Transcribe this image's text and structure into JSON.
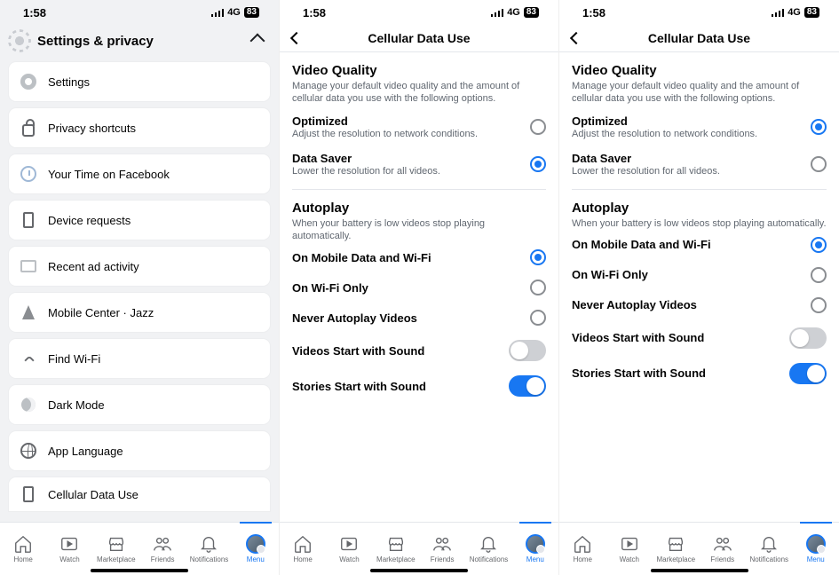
{
  "status": {
    "time": "1:58",
    "net": "4G",
    "battery": "83"
  },
  "screenA": {
    "header": "Settings & privacy",
    "items": [
      {
        "label": "Settings"
      },
      {
        "label": "Privacy shortcuts"
      },
      {
        "label": "Your Time on Facebook"
      },
      {
        "label": "Device requests"
      },
      {
        "label": "Recent ad activity"
      },
      {
        "label": "Mobile Center · Jazz"
      },
      {
        "label": "Find Wi-Fi"
      },
      {
        "label": "Dark Mode"
      },
      {
        "label": "App Language"
      },
      {
        "label": "Cellular Data Use"
      }
    ]
  },
  "cellular": {
    "title": "Cellular Data Use",
    "video": {
      "heading": "Video Quality",
      "desc": "Manage your default video quality and the amount of cellular data you use with the following options.",
      "optimized": {
        "title": "Optimized",
        "desc": "Adjust the resolution to network conditions."
      },
      "datasaver": {
        "title": "Data Saver",
        "desc": "Lower the resolution for all videos."
      }
    },
    "autoplay": {
      "heading": "Autoplay",
      "desc": "When your battery is low videos stop playing automatically.",
      "opt1": "On Mobile Data and Wi-Fi",
      "opt2": "On Wi-Fi Only",
      "opt3": "Never Autoplay Videos",
      "sound_videos": "Videos Start with Sound",
      "sound_stories": "Stories Start with Sound"
    }
  },
  "screenB_state": {
    "video_selected": "datasaver",
    "autoplay_selected": "opt1",
    "videos_sound": false,
    "stories_sound": true
  },
  "screenC_state": {
    "video_selected": "optimized",
    "autoplay_selected": "opt1",
    "videos_sound": false,
    "stories_sound": true
  },
  "tabs": {
    "home": "Home",
    "watch": "Watch",
    "marketplace": "Marketplace",
    "friends": "Friends",
    "notifications": "Notifications",
    "menu": "Menu"
  }
}
